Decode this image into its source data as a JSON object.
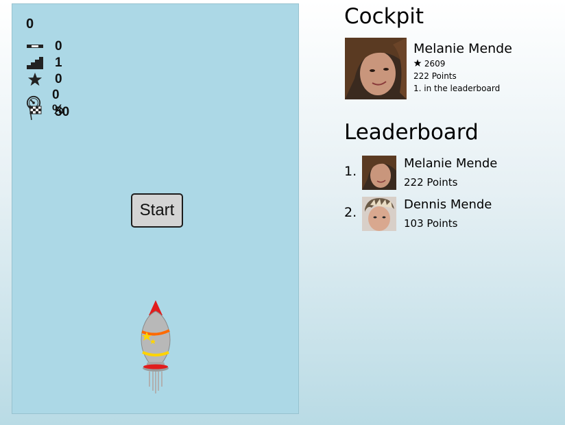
{
  "hud": {
    "score": "0",
    "stats": [
      {
        "icon": "distance-bar-icon",
        "value": "0"
      },
      {
        "icon": "level-stairs-icon",
        "value": "1"
      },
      {
        "icon": "star-icon",
        "value": "0"
      },
      {
        "icon": "speedometer-icon",
        "value": "0 %"
      },
      {
        "icon": "checkered-flag-icon",
        "value": "50"
      }
    ]
  },
  "game": {
    "start_label": "Start"
  },
  "cockpit": {
    "title": "Cockpit",
    "user": {
      "name": "Melanie Mende",
      "stars": "2609",
      "points": "222 Points",
      "rank_text": "1. in the leaderboard"
    }
  },
  "leaderboard": {
    "title": "Leaderboard",
    "entries": [
      {
        "rank": "1.",
        "name": "Melanie Mende",
        "points": "222 Points"
      },
      {
        "rank": "2.",
        "name": "Dennis Mende",
        "points": "103 Points"
      }
    ]
  },
  "colors": {
    "game_bg": "#acd8e6",
    "rocket_tip": "#e11d1d",
    "rocket_band_orange": "#ff6a00",
    "rocket_band_yellow": "#ffd400"
  }
}
